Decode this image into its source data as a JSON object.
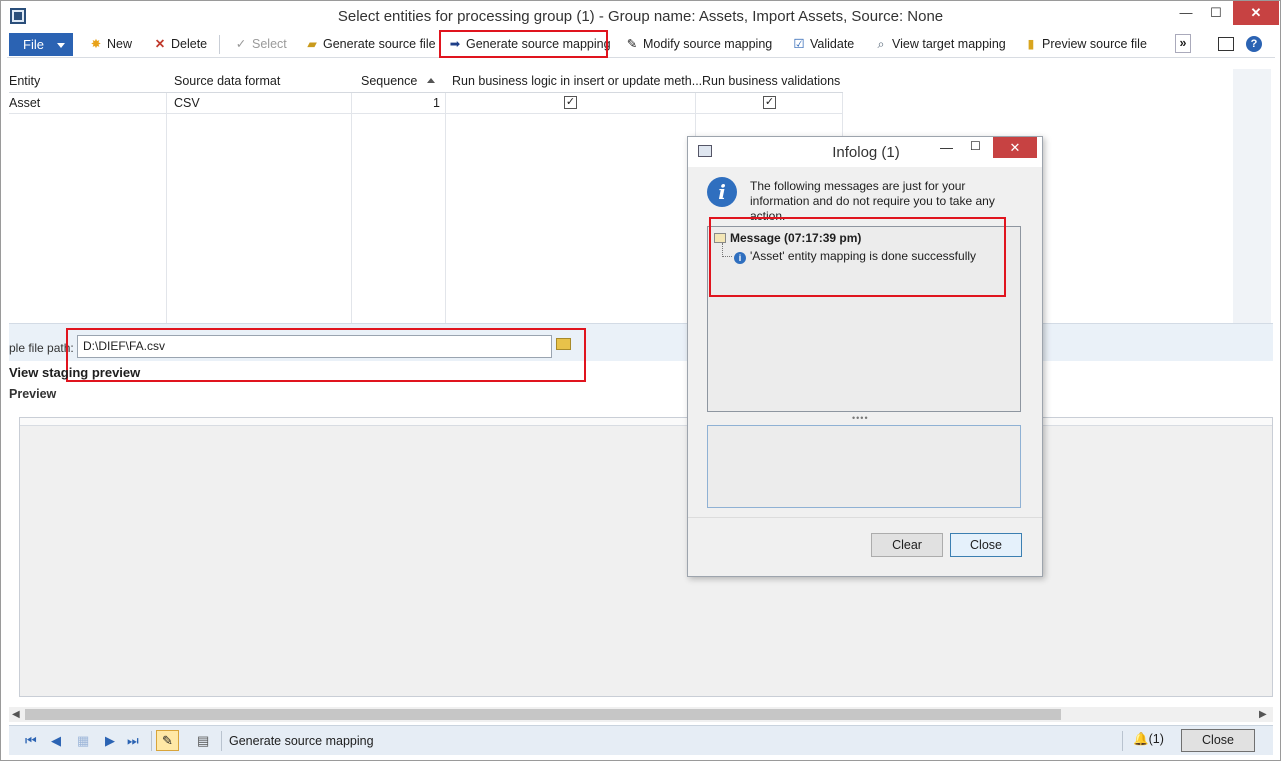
{
  "window": {
    "title": "Select entities for processing group (1) - Group name: Assets, Import Assets, Source: None",
    "min_glyph": "—",
    "max_glyph": "☐",
    "close_glyph": "✕"
  },
  "toolbar": {
    "file_label": "File",
    "new_label": "New",
    "delete_label": "Delete",
    "select_label": "Select",
    "generate_source_file_label": "Generate source file",
    "generate_source_mapping_label": "Generate source mapping",
    "modify_source_mapping_label": "Modify source mapping",
    "validate_label": "Validate",
    "view_target_mapping_label": "View target mapping",
    "preview_source_file_label": "Preview source file",
    "overflow_label": "»",
    "help_label": "?"
  },
  "grid": {
    "columns": [
      "Entity",
      "Source data format",
      "Sequence",
      "Run business logic in insert or update meth...",
      "Run business validations"
    ],
    "rows": [
      {
        "entity": "Asset",
        "format": "CSV",
        "sequence": "1",
        "run_business_logic": true,
        "run_business_validations": true
      }
    ]
  },
  "source": {
    "path_label": "ple file path:",
    "path_value": "D:\\DIEF\\FA.csv"
  },
  "staging": {
    "title": "View staging preview",
    "preview_label": "Preview"
  },
  "statusbar": {
    "status_text": "Generate source mapping",
    "notifications": "(1)",
    "close_label": "Close"
  },
  "infolog": {
    "title": "Infolog (1)",
    "info_text": "The following messages are just for your information and do not require you to take any action.",
    "message_header": "Message (07:17:39 pm)",
    "message_text": "'Asset' entity mapping is done successfully",
    "clear_label": "Clear",
    "close_label": "Close"
  },
  "colors": {
    "accent": "#2b63b3",
    "highlight_box": "#e0141e",
    "close_red": "#c74242"
  },
  "icons": [
    "app-icon",
    "new-icon",
    "delete-icon",
    "select-icon",
    "generate-file-icon",
    "arrow-right-icon",
    "pencil-icon",
    "checkbox-icon",
    "view-mapping-icon",
    "cylinder-icon",
    "panel-icon",
    "help-icon",
    "folder-icon",
    "info-icon",
    "bell-icon"
  ]
}
